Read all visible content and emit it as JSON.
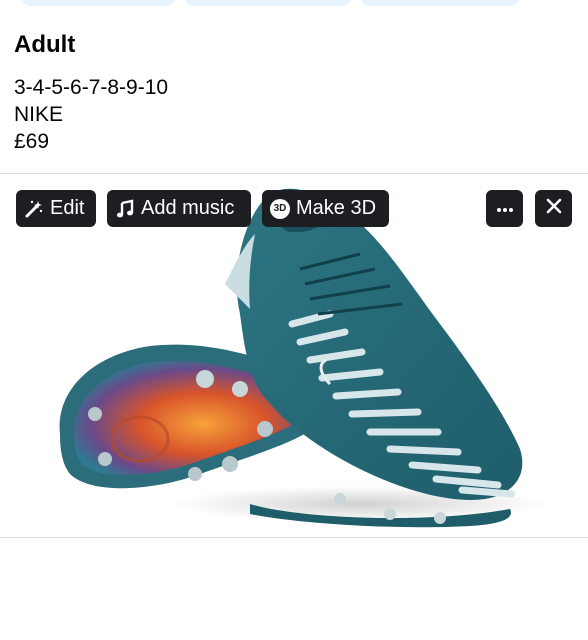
{
  "post": {
    "title": "Adult",
    "sizes": "3-4-5-6-7-8-9-10",
    "brand": "NIKE",
    "price": "£69"
  },
  "toolbar": {
    "edit_label": "Edit",
    "music_label": "Add music",
    "threed_label": "Make 3D",
    "threed_badge": "3D"
  },
  "icons": {
    "edit": "magic-wand-icon",
    "music": "music-note-icon",
    "threed": "3d-cube-icon",
    "more": "more-dots-icon",
    "close": "close-icon"
  },
  "colors": {
    "toolbar_bg": "#1c1e21",
    "pill_bg": "#e7f3ff",
    "divider": "#dadde1",
    "boot_teal": "#2b6d7a"
  }
}
